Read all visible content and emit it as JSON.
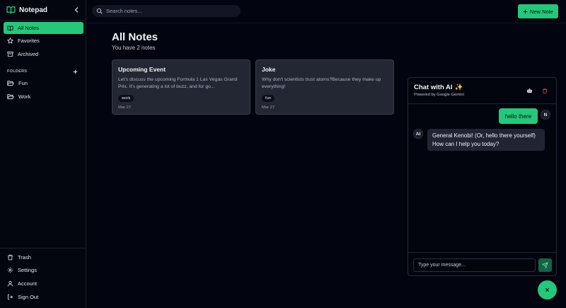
{
  "app": {
    "title": "Notepad"
  },
  "colors": {
    "accent": "#25c77a",
    "background": "#02040f",
    "card": "#232633",
    "danger": "#e0414f"
  },
  "sidebar": {
    "nav": [
      {
        "label": "All Notes",
        "icon": "book-open-icon",
        "active": true
      },
      {
        "label": "Favorites",
        "icon": "star-icon"
      },
      {
        "label": "Archived",
        "icon": "archive-icon"
      }
    ],
    "folders_header": "FOLDERS",
    "folders": [
      {
        "label": "Fun",
        "icon": "folder-open-icon"
      },
      {
        "label": "Work",
        "icon": "folder-open-icon"
      }
    ],
    "bottom": [
      {
        "label": "Trash",
        "icon": "trash-icon"
      },
      {
        "label": "Settings",
        "icon": "gear-icon"
      },
      {
        "label": "Account",
        "icon": "user-icon"
      },
      {
        "label": "Sign Out",
        "icon": "sign-out-icon"
      }
    ]
  },
  "search": {
    "placeholder": "Search notes..."
  },
  "toolbar": {
    "new_note_label": "New Note"
  },
  "main": {
    "title": "All Notes",
    "subtitle": "You have 2 notes",
    "notes": [
      {
        "title": "Upcoming Event",
        "body": "Let's discuss the upcoming Formula 1 Las Vegas Grand Prix. It's generating a lot of buzz, and for go...",
        "tag": "work",
        "date": "Mar 27"
      },
      {
        "title": "Joke",
        "body": "Why don't scientists trust atoms?Because they make up everything!",
        "tag": "fun",
        "date": "Mar 27"
      }
    ]
  },
  "chat": {
    "title": "Chat with AI",
    "title_emoji": "✨",
    "subtitle": "Powered by Google Gemini",
    "messages": [
      {
        "role": "user",
        "avatar": "N",
        "text": "hello there"
      },
      {
        "role": "ai",
        "avatar": "AI",
        "text": "General Kenobi! (Or, hello there yourself) How can I help you today?"
      }
    ],
    "input_placeholder": "Type your message..."
  }
}
